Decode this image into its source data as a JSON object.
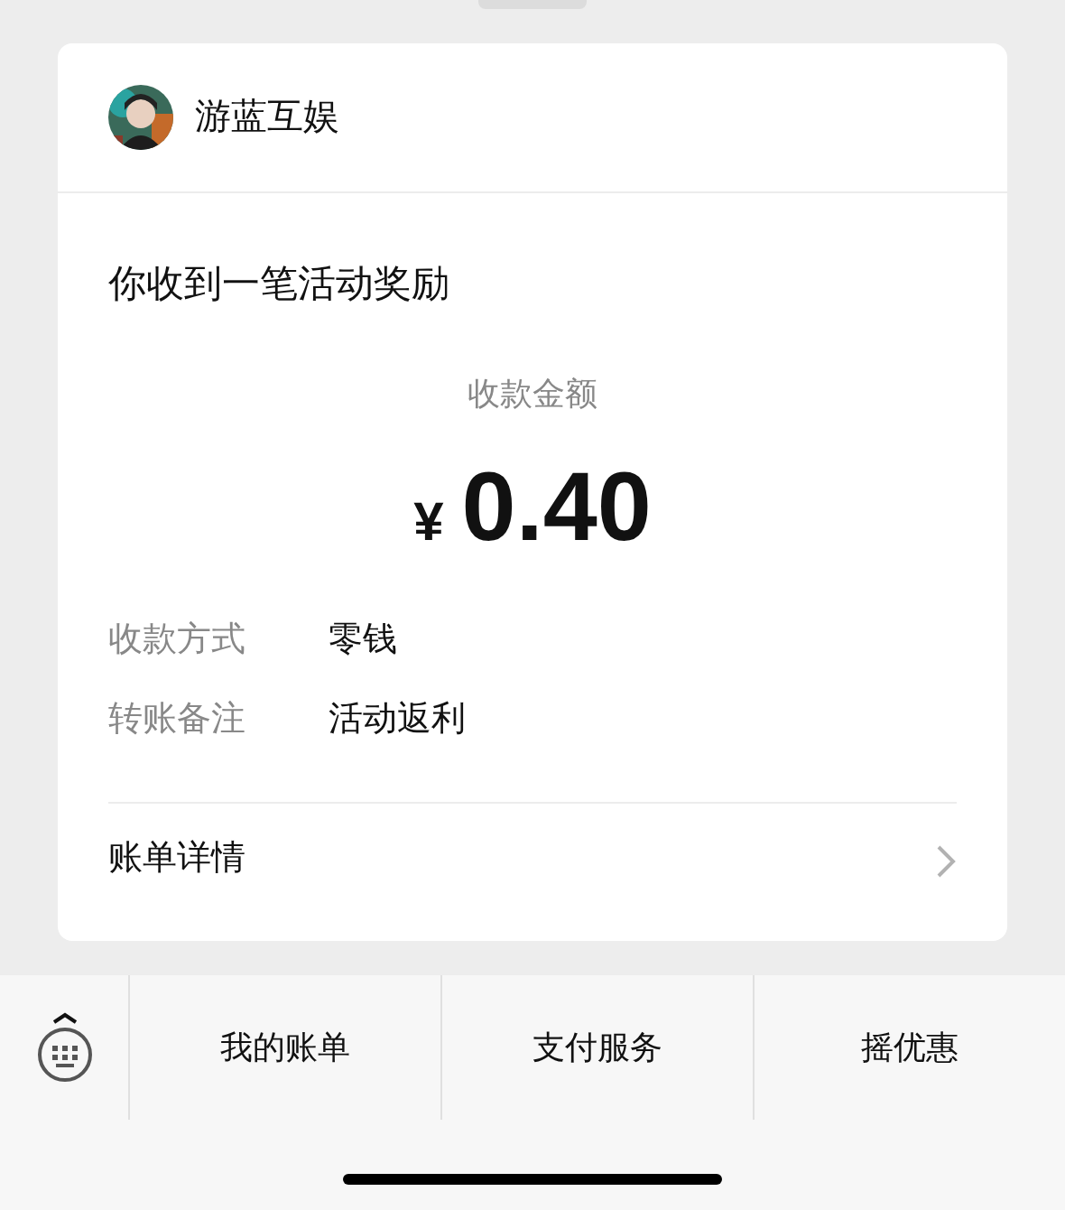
{
  "sender": {
    "name": "游蓝互娱"
  },
  "message": {
    "title": "你收到一笔活动奖励",
    "amount_label": "收款金额",
    "currency": "¥",
    "amount": "0.40"
  },
  "details": [
    {
      "label": "收款方式",
      "value": "零钱"
    },
    {
      "label": "转账备注",
      "value": "活动返利"
    }
  ],
  "bill_link": {
    "label": "账单详情"
  },
  "menu": [
    {
      "label": "我的账单"
    },
    {
      "label": "支付服务"
    },
    {
      "label": "摇优惠"
    }
  ]
}
